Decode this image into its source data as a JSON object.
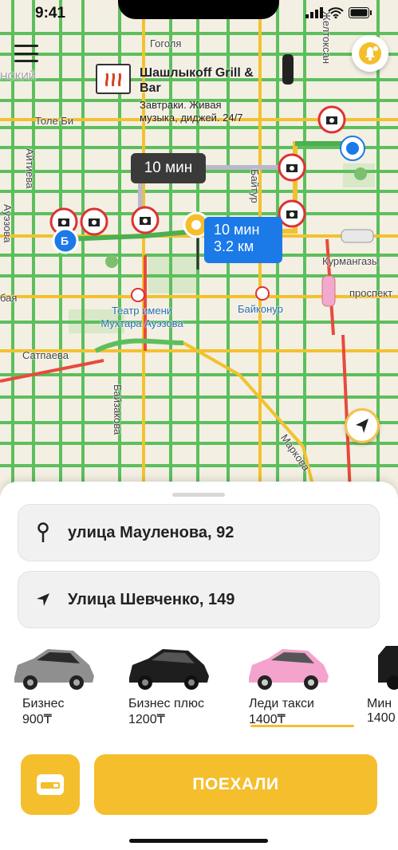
{
  "status_bar": {
    "time": "9:41"
  },
  "map": {
    "streets": {
      "gogolya": "Гоголя",
      "nsky": "НСКИЙ",
      "tole_bi": "Толе Би",
      "aitieva": "Айтиева",
      "auezova": "Ауэзова",
      "zheltoksan": "Желтоксан",
      "baitursynova": "Байтур",
      "kurmangazy": "Курмангазы",
      "prospekt": "проспект",
      "baya": "бая",
      "satpaeva": "Сатпаева",
      "baizakova": "Байзакова",
      "markova": "Маркова",
      "zheltoksan_short": "Желтоксан",
      "a_letter": "А"
    },
    "poi": {
      "title": "Шашлыкоff Grill & Bar",
      "desc": "Завтраки. Живая музыка, диджей. 24/7"
    },
    "theatre": "Театр имени Мухтара Ауэзова",
    "metro_station": "Байконур",
    "bubble_grey": "10 мин",
    "bubble_blue_time": "10 мин",
    "bubble_blue_dist": "3.2 км",
    "point_b": "Б",
    "metro_letter": "M"
  },
  "sheet": {
    "from_address": "улица Мауленова, 92",
    "to_address": "Улица Шевченко, 149",
    "tariffs": [
      {
        "name": "Бизнес",
        "price": "900₸",
        "color": "#9a9a9a"
      },
      {
        "name": "Бизнес плюс",
        "price": "1200₸",
        "color": "#222222"
      },
      {
        "name": "Леди такси",
        "price": "1400₸",
        "color": "#f4a3cc"
      },
      {
        "name": "Мин",
        "price": "1400",
        "color": "#1c1c1c"
      }
    ],
    "selected_tariff": "Леди такси",
    "go_button": "ПОЕХАЛИ"
  },
  "colors": {
    "accent": "#f5be2c",
    "route_blue": "#1b79e8"
  }
}
